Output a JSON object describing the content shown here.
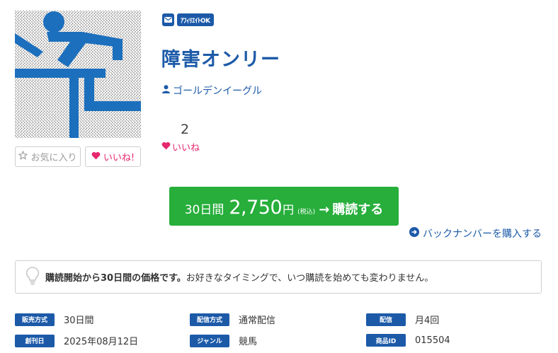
{
  "badges": {
    "affiliate": "ｱﾌｨﾘｴｲﾄOK"
  },
  "magazine": {
    "title": "障害オンリー",
    "author": "ゴールデンイーグル"
  },
  "favorites": {
    "okini_label": "お気に入り",
    "iine_label": "いいね!"
  },
  "likes": {
    "count": "2",
    "label": "いいね"
  },
  "subscribe": {
    "days": "30日間",
    "price": "2,750",
    "yen": "円",
    "tax": "(税込)",
    "arrow": "→",
    "action": "購読する"
  },
  "back_number": {
    "label": "バックナンバーを購入する"
  },
  "notice": {
    "bold": "購読開始から30日間の価格です。",
    "text": "お好きなタイミングで、いつ購読を始めても変わりません。"
  },
  "meta": [
    {
      "label": "販売方式",
      "value": "30日間"
    },
    {
      "label": "配信方式",
      "value": "通常配信"
    },
    {
      "label": "配信",
      "value": "月4回"
    },
    {
      "label": "創刊日",
      "value": "2025年08月12日"
    },
    {
      "label": "ジャンル",
      "value": "競馬"
    },
    {
      "label": "商品ID",
      "value": "015504"
    }
  ],
  "colors": {
    "brand": "#1c5aa8",
    "subscribe": "#27ae3b",
    "like": "#e5286f"
  },
  "icons": {
    "mail": "mail-icon",
    "author": "user-icon",
    "like": "heart-icon",
    "star": "star-icon",
    "back_number": "circle-arrow-right-icon",
    "notice": "lightbulb-icon"
  }
}
